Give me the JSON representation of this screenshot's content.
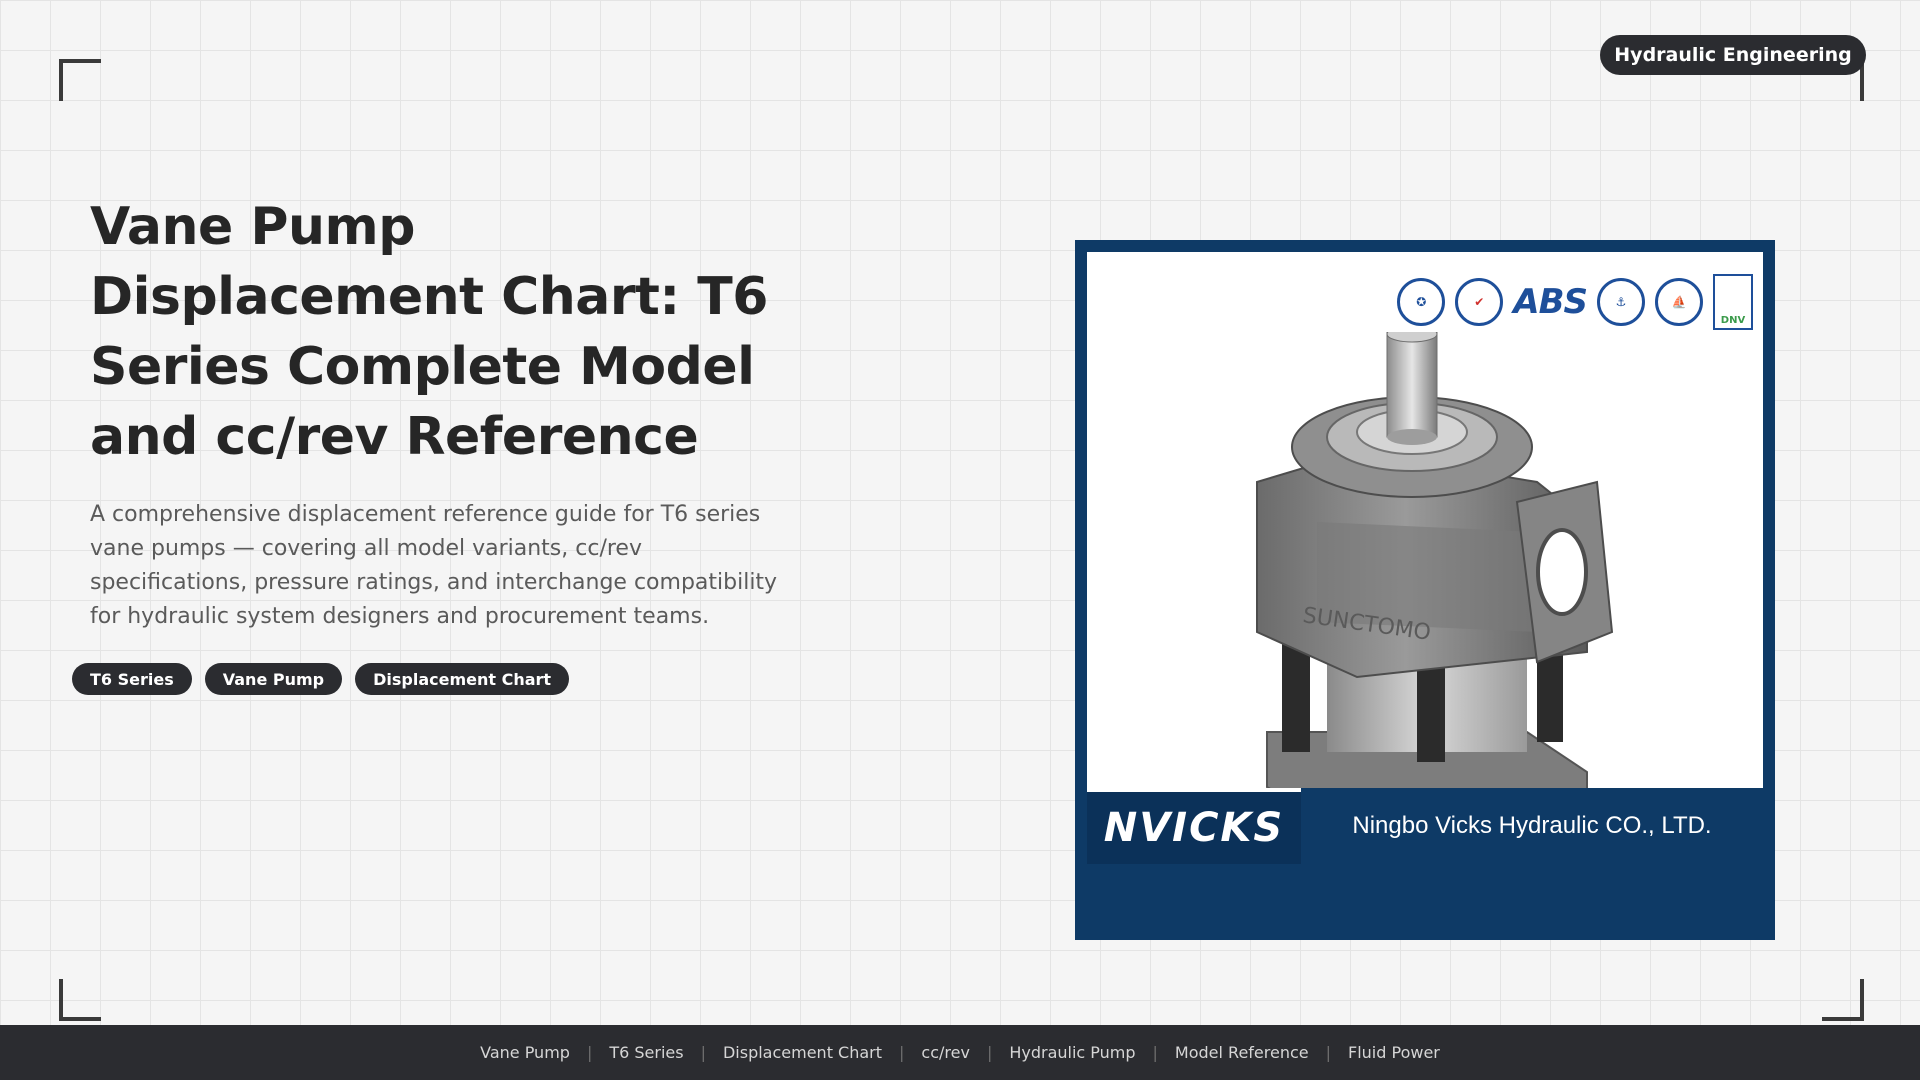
{
  "badge": "Hydraulic Engineering",
  "title": "Vane Pump Displacement Chart: T6 Series Complete Model and cc/rev Reference",
  "description": "A comprehensive displacement reference guide for T6 series vane pumps — covering all model variants, cc/rev specifications, pressure ratings, and interchange compatibility for hydraulic system designers and procurement teams.",
  "tags": [
    "T6 Series",
    "Vane Pump",
    "Displacement Chart"
  ],
  "image": {
    "brand": "NVICKS",
    "company": "Ningbo Vicks Hydraulic CO., LTD.",
    "cert_abs": "ABS",
    "cert_dnv": "DNV",
    "pump_casting": "SUNCTOMO",
    "icons": [
      "cert-seal-icon",
      "cert-check-icon",
      "cert-anchor-icon",
      "cert-ship-icon"
    ]
  },
  "footer": {
    "links": [
      "Vane Pump",
      "T6 Series",
      "Displacement Chart",
      "cc/rev",
      "Hydraulic Pump",
      "Model Reference",
      "Fluid Power"
    ]
  },
  "colors": {
    "background": "#f5f5f5",
    "dark": "#2b2c30",
    "image_frame": "#0e3a66"
  }
}
